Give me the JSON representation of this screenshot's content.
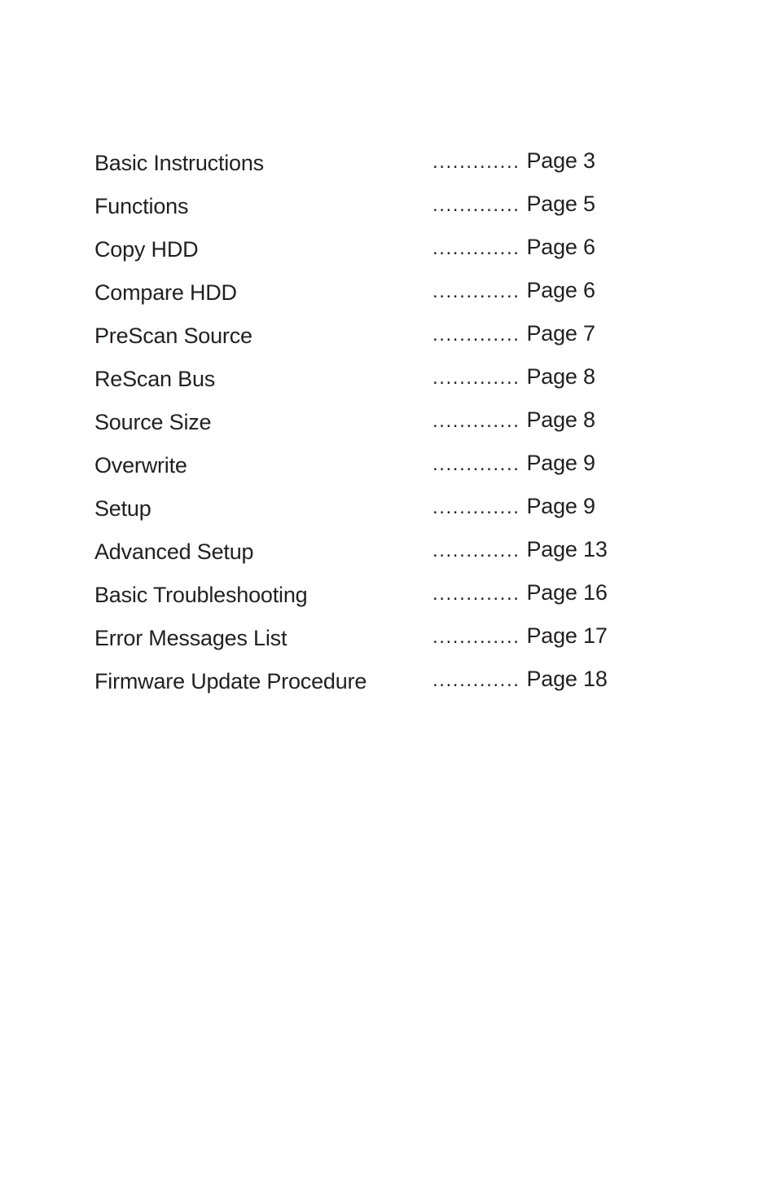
{
  "toc": {
    "leader": ".............",
    "entries": [
      {
        "title": "Basic Instructions",
        "page": "Page 3"
      },
      {
        "title": "Functions",
        "page": "Page 5"
      },
      {
        "title": "Copy HDD",
        "page": "Page 6"
      },
      {
        "title": "Compare HDD",
        "page": "Page 6"
      },
      {
        "title": "PreScan Source",
        "page": "Page 7"
      },
      {
        "title": "ReScan Bus",
        "page": "Page 8"
      },
      {
        "title": "Source Size",
        "page": "Page 8"
      },
      {
        "title": "Overwrite",
        "page": "Page 9"
      },
      {
        "title": "Setup",
        "page": "Page 9"
      },
      {
        "title": "Advanced Setup",
        "page": "Page 13"
      },
      {
        "title": "Basic Troubleshooting",
        "page": "Page 16"
      },
      {
        "title": "Error Messages List",
        "page": "Page 17"
      },
      {
        "title": "Firmware Update Procedure",
        "page": "Page 18"
      }
    ]
  }
}
